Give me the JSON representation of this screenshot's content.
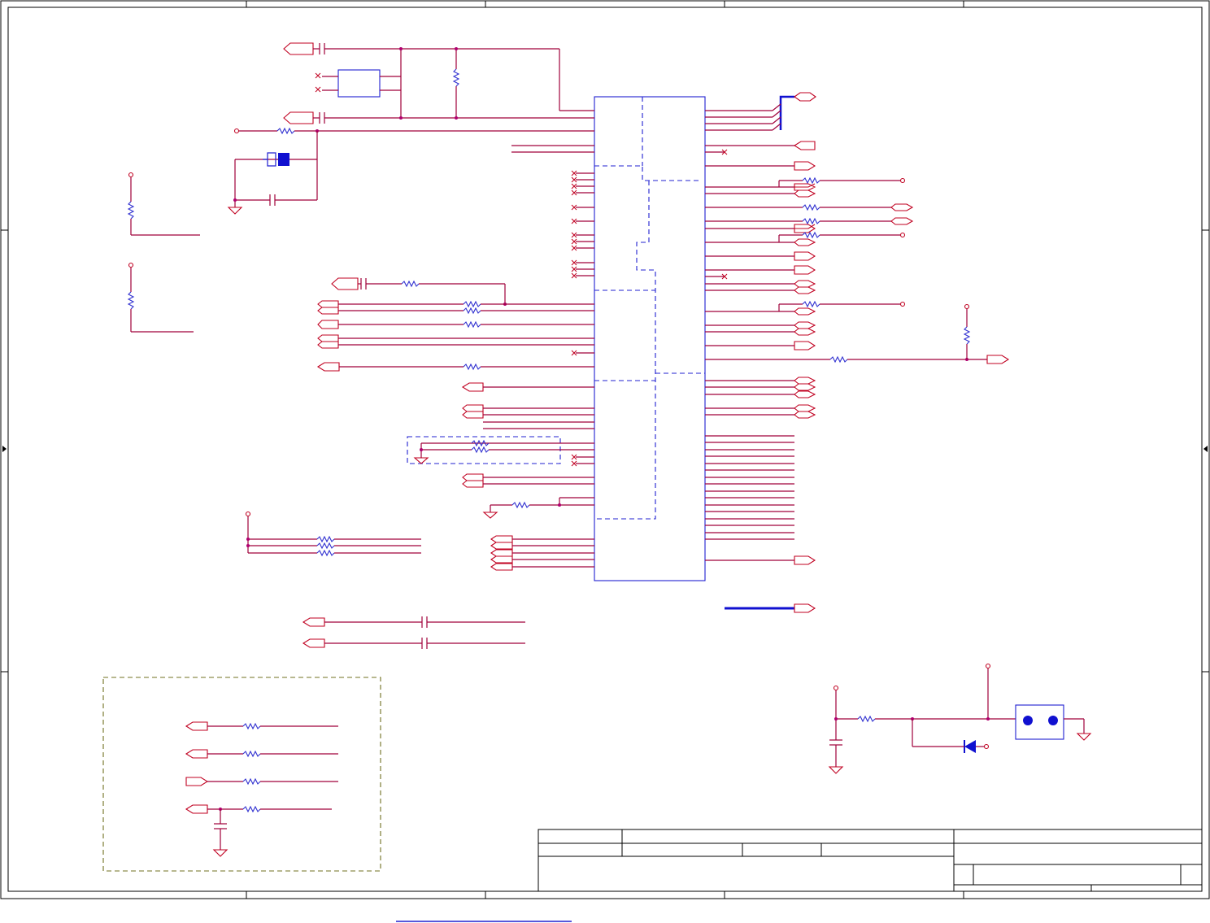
{
  "diagram": {
    "kind": "electrical schematic sheet",
    "colors": {
      "wire": "#a0003a",
      "component": "#3030d0",
      "border": "#000000",
      "annotation_box": "#707020",
      "port_outline": "#c00020"
    },
    "visible_text": []
  }
}
